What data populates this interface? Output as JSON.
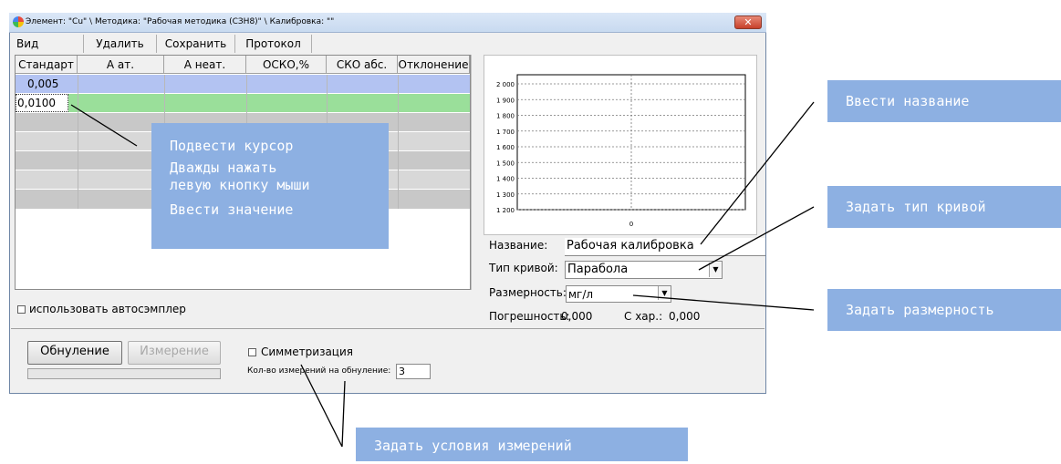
{
  "window": {
    "title": "Элемент: \"Cu\" \\ Методика: \"Рабочая методика (СЗН8)\" \\ Калибровка: \"\"",
    "close_label": "✕"
  },
  "menu": [
    "Вид",
    "Удалить",
    "Сохранить",
    "Протокол"
  ],
  "table": {
    "columns": [
      "Стандарт",
      "А ат.",
      "А неат.",
      "ОСКО,%",
      "СКО абс.",
      "Отклонение"
    ],
    "rows": [
      {
        "standard": "0,005"
      },
      {
        "standard": "0,0100"
      }
    ]
  },
  "chart_data": {
    "type": "line",
    "y_ticks": [
      "2 000",
      "1 900",
      "1 800",
      "1 700",
      "1 600",
      "1 500",
      "1 400",
      "1 300",
      "1 200"
    ],
    "x_ticks": [
      "0"
    ],
    "ylim": [
      1200,
      2000
    ],
    "grid": true,
    "series": []
  },
  "props": {
    "name_label": "Название:",
    "name_value": "Рабочая калибровка",
    "curve_label": "Тип кривой:",
    "curve_value": "Парабола",
    "unit_label": "Размерность:",
    "unit_value": "мг/л",
    "error_label": "Погрешность:",
    "error_value": "0,000",
    "char_label": "С хар.:",
    "char_value": "0,000"
  },
  "autosampler_label": "использовать автосэмплер",
  "buttons": {
    "zero": "Обнуление",
    "measure": "Измерение"
  },
  "symmetrization_label": "Симметризация",
  "count_label": "Кол-во измерений на обнуление:",
  "count_value": "3",
  "notes": {
    "cursor": [
      "Подвести курсор",
      "Дважды нажать",
      "левую кнопку мыши",
      "Ввести значение"
    ],
    "name": "Ввести название",
    "curve": "Задать тип кривой",
    "unit": "Задать размерность",
    "conditions": "Задать условия измерений"
  },
  "colors": {
    "row_blue": "#b3c3f2",
    "row_green": "#9adf9a",
    "row_gray": "#c8c8c8",
    "note_bg": "#8db0e2"
  }
}
